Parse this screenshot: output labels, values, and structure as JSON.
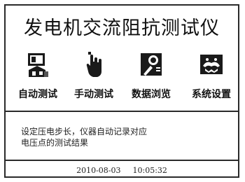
{
  "title": "发电机交流阻抗测试仪",
  "menu": {
    "items": [
      {
        "label": "自动测试",
        "icon": "auto-test-icon"
      },
      {
        "label": "手动测试",
        "icon": "manual-test-icon"
      },
      {
        "label": "数据浏览",
        "icon": "data-browse-icon"
      },
      {
        "label": "系统设置",
        "icon": "system-settings-icon"
      }
    ]
  },
  "description": {
    "line1": "设定压电步长，仪器自动记录对应",
    "line2": "电压点的测试结果"
  },
  "status": {
    "date": "2010-08-03",
    "time": "10:05:32"
  }
}
